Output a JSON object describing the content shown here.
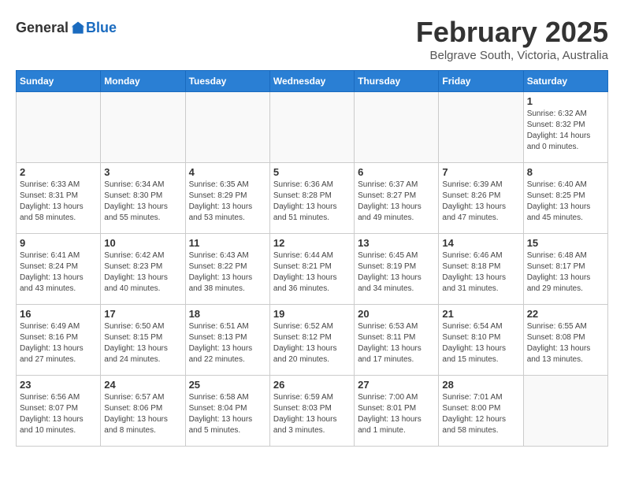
{
  "header": {
    "logo_general": "General",
    "logo_blue": "Blue",
    "title": "February 2025",
    "subtitle": "Belgrave South, Victoria, Australia"
  },
  "calendar": {
    "days_of_week": [
      "Sunday",
      "Monday",
      "Tuesday",
      "Wednesday",
      "Thursday",
      "Friday",
      "Saturday"
    ],
    "weeks": [
      [
        {
          "day": "",
          "info": ""
        },
        {
          "day": "",
          "info": ""
        },
        {
          "day": "",
          "info": ""
        },
        {
          "day": "",
          "info": ""
        },
        {
          "day": "",
          "info": ""
        },
        {
          "day": "",
          "info": ""
        },
        {
          "day": "1",
          "info": "Sunrise: 6:32 AM\nSunset: 8:32 PM\nDaylight: 14 hours\nand 0 minutes."
        }
      ],
      [
        {
          "day": "2",
          "info": "Sunrise: 6:33 AM\nSunset: 8:31 PM\nDaylight: 13 hours\nand 58 minutes."
        },
        {
          "day": "3",
          "info": "Sunrise: 6:34 AM\nSunset: 8:30 PM\nDaylight: 13 hours\nand 55 minutes."
        },
        {
          "day": "4",
          "info": "Sunrise: 6:35 AM\nSunset: 8:29 PM\nDaylight: 13 hours\nand 53 minutes."
        },
        {
          "day": "5",
          "info": "Sunrise: 6:36 AM\nSunset: 8:28 PM\nDaylight: 13 hours\nand 51 minutes."
        },
        {
          "day": "6",
          "info": "Sunrise: 6:37 AM\nSunset: 8:27 PM\nDaylight: 13 hours\nand 49 minutes."
        },
        {
          "day": "7",
          "info": "Sunrise: 6:39 AM\nSunset: 8:26 PM\nDaylight: 13 hours\nand 47 minutes."
        },
        {
          "day": "8",
          "info": "Sunrise: 6:40 AM\nSunset: 8:25 PM\nDaylight: 13 hours\nand 45 minutes."
        }
      ],
      [
        {
          "day": "9",
          "info": "Sunrise: 6:41 AM\nSunset: 8:24 PM\nDaylight: 13 hours\nand 43 minutes."
        },
        {
          "day": "10",
          "info": "Sunrise: 6:42 AM\nSunset: 8:23 PM\nDaylight: 13 hours\nand 40 minutes."
        },
        {
          "day": "11",
          "info": "Sunrise: 6:43 AM\nSunset: 8:22 PM\nDaylight: 13 hours\nand 38 minutes."
        },
        {
          "day": "12",
          "info": "Sunrise: 6:44 AM\nSunset: 8:21 PM\nDaylight: 13 hours\nand 36 minutes."
        },
        {
          "day": "13",
          "info": "Sunrise: 6:45 AM\nSunset: 8:19 PM\nDaylight: 13 hours\nand 34 minutes."
        },
        {
          "day": "14",
          "info": "Sunrise: 6:46 AM\nSunset: 8:18 PM\nDaylight: 13 hours\nand 31 minutes."
        },
        {
          "day": "15",
          "info": "Sunrise: 6:48 AM\nSunset: 8:17 PM\nDaylight: 13 hours\nand 29 minutes."
        }
      ],
      [
        {
          "day": "16",
          "info": "Sunrise: 6:49 AM\nSunset: 8:16 PM\nDaylight: 13 hours\nand 27 minutes."
        },
        {
          "day": "17",
          "info": "Sunrise: 6:50 AM\nSunset: 8:15 PM\nDaylight: 13 hours\nand 24 minutes."
        },
        {
          "day": "18",
          "info": "Sunrise: 6:51 AM\nSunset: 8:13 PM\nDaylight: 13 hours\nand 22 minutes."
        },
        {
          "day": "19",
          "info": "Sunrise: 6:52 AM\nSunset: 8:12 PM\nDaylight: 13 hours\nand 20 minutes."
        },
        {
          "day": "20",
          "info": "Sunrise: 6:53 AM\nSunset: 8:11 PM\nDaylight: 13 hours\nand 17 minutes."
        },
        {
          "day": "21",
          "info": "Sunrise: 6:54 AM\nSunset: 8:10 PM\nDaylight: 13 hours\nand 15 minutes."
        },
        {
          "day": "22",
          "info": "Sunrise: 6:55 AM\nSunset: 8:08 PM\nDaylight: 13 hours\nand 13 minutes."
        }
      ],
      [
        {
          "day": "23",
          "info": "Sunrise: 6:56 AM\nSunset: 8:07 PM\nDaylight: 13 hours\nand 10 minutes."
        },
        {
          "day": "24",
          "info": "Sunrise: 6:57 AM\nSunset: 8:06 PM\nDaylight: 13 hours\nand 8 minutes."
        },
        {
          "day": "25",
          "info": "Sunrise: 6:58 AM\nSunset: 8:04 PM\nDaylight: 13 hours\nand 5 minutes."
        },
        {
          "day": "26",
          "info": "Sunrise: 6:59 AM\nSunset: 8:03 PM\nDaylight: 13 hours\nand 3 minutes."
        },
        {
          "day": "27",
          "info": "Sunrise: 7:00 AM\nSunset: 8:01 PM\nDaylight: 13 hours\nand 1 minute."
        },
        {
          "day": "28",
          "info": "Sunrise: 7:01 AM\nSunset: 8:00 PM\nDaylight: 12 hours\nand 58 minutes."
        },
        {
          "day": "",
          "info": ""
        }
      ]
    ]
  }
}
